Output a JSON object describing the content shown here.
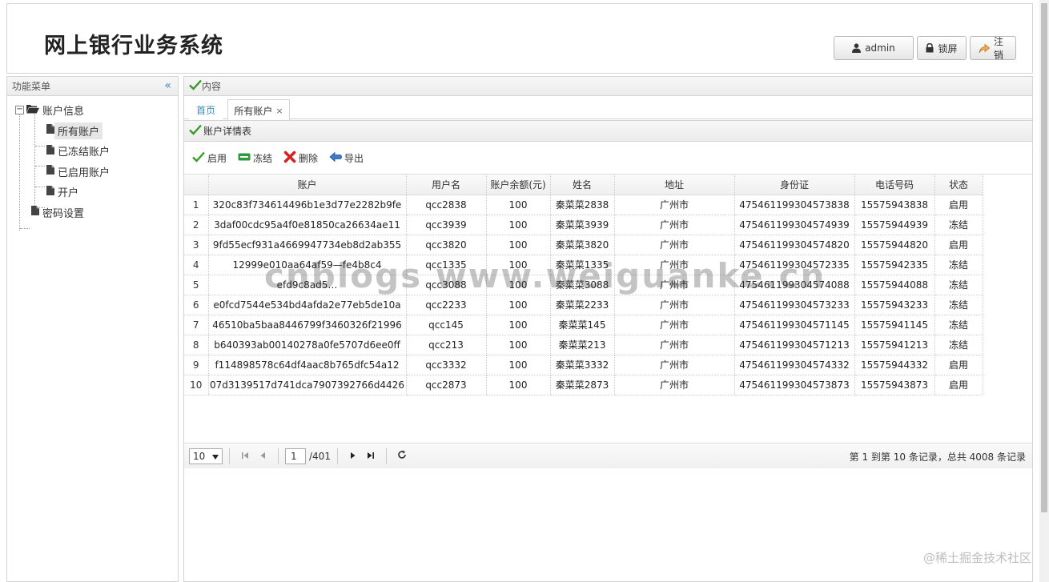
{
  "app": {
    "title": "网上银行业务系统"
  },
  "header": {
    "user_label": "admin",
    "lock_label": "锁屏",
    "logout_label": "注销"
  },
  "sidebar": {
    "title": "功能菜单",
    "collapse_icon": "«",
    "tree": {
      "group_label": "账户信息",
      "toggle": "−",
      "items": [
        {
          "label": "所有账户"
        },
        {
          "label": "已冻结账户"
        },
        {
          "label": "已启用账户"
        },
        {
          "label": "开户"
        }
      ],
      "password_label": "密码设置"
    }
  },
  "main": {
    "panel_title": "内容",
    "tabs": [
      {
        "label": "首页"
      },
      {
        "label": "所有账户",
        "close": "×"
      }
    ],
    "grid": {
      "title": "账户详情表",
      "toolbar": {
        "enable_label": "启用",
        "freeze_label": "冻结",
        "delete_label": "删除",
        "export_label": "导出"
      },
      "columns": [
        "账户",
        "用户名",
        "账户余额(元)",
        "姓名",
        "地址",
        "身份证",
        "电话号码",
        "状态"
      ],
      "rows": [
        {
          "n": "1",
          "account": "320c83f734614496b1e3d77e2282b9fe",
          "username": "qcc2838",
          "balance": "100",
          "name": "秦菜菜2838",
          "address": "广州市",
          "id_card": "475461199304573838",
          "phone": "15575943838",
          "status": "启用"
        },
        {
          "n": "2",
          "account": "3daf00cdc95a4f0e81850ca26634ae11",
          "username": "qcc3939",
          "balance": "100",
          "name": "秦菜菜3939",
          "address": "广州市",
          "id_card": "475461199304574939",
          "phone": "15575944939",
          "status": "冻结"
        },
        {
          "n": "3",
          "account": "9fd55ecf931a4669947734eb8d2ab355",
          "username": "qcc3820",
          "balance": "100",
          "name": "秦菜菜3820",
          "address": "广州市",
          "id_card": "475461199304574820",
          "phone": "15575944820",
          "status": "启用"
        },
        {
          "n": "4",
          "account": "12999e010aa64af59—fe4b8c4",
          "username": "qcc1335",
          "balance": "100",
          "name": "秦菜菜1335",
          "address": "广州市",
          "id_card": "475461199304572335",
          "phone": "15575942335",
          "status": "冻结"
        },
        {
          "n": "5",
          "account": "efd9c8ad5…",
          "username": "qcc3088",
          "balance": "100",
          "name": "秦菜菜3088",
          "address": "广州市",
          "id_card": "475461199304574088",
          "phone": "15575944088",
          "status": "冻结"
        },
        {
          "n": "6",
          "account": "e0fcd7544e534bd4afda2e77eb5de10a",
          "username": "qcc2233",
          "balance": "100",
          "name": "秦菜菜2233",
          "address": "广州市",
          "id_card": "475461199304573233",
          "phone": "15575943233",
          "status": "冻结"
        },
        {
          "n": "7",
          "account": "46510ba5baa8446799f3460326f21996",
          "username": "qcc145",
          "balance": "100",
          "name": "秦菜菜145",
          "address": "广州市",
          "id_card": "475461199304571145",
          "phone": "15575941145",
          "status": "冻结"
        },
        {
          "n": "8",
          "account": "b640393ab00140278a0fe5707d6ee0ff",
          "username": "qcc213",
          "balance": "100",
          "name": "秦菜菜213",
          "address": "广州市",
          "id_card": "475461199304571213",
          "phone": "15575941213",
          "status": "冻结"
        },
        {
          "n": "9",
          "account": "f114898578c64df4aac8b765dfc54a12",
          "username": "qcc3332",
          "balance": "100",
          "name": "秦菜菜3332",
          "address": "广州市",
          "id_card": "475461199304574332",
          "phone": "15575944332",
          "status": "启用"
        },
        {
          "n": "10",
          "account": "07d3139517d741dca7907392766d4426",
          "username": "qcc2873",
          "balance": "100",
          "name": "秦菜菜2873",
          "address": "广州市",
          "id_card": "475461199304573873",
          "phone": "15575943873",
          "status": "启用"
        }
      ]
    },
    "pager": {
      "page_size": "10",
      "page_input": "1",
      "page_total": "/401",
      "info": "第 1 到第 10 条记录，总共 4008 条记录"
    }
  },
  "overlay": {
    "watermark": "cnblogs www.weiguanke.cn",
    "credit": "@稀土掘金技术社区"
  }
}
